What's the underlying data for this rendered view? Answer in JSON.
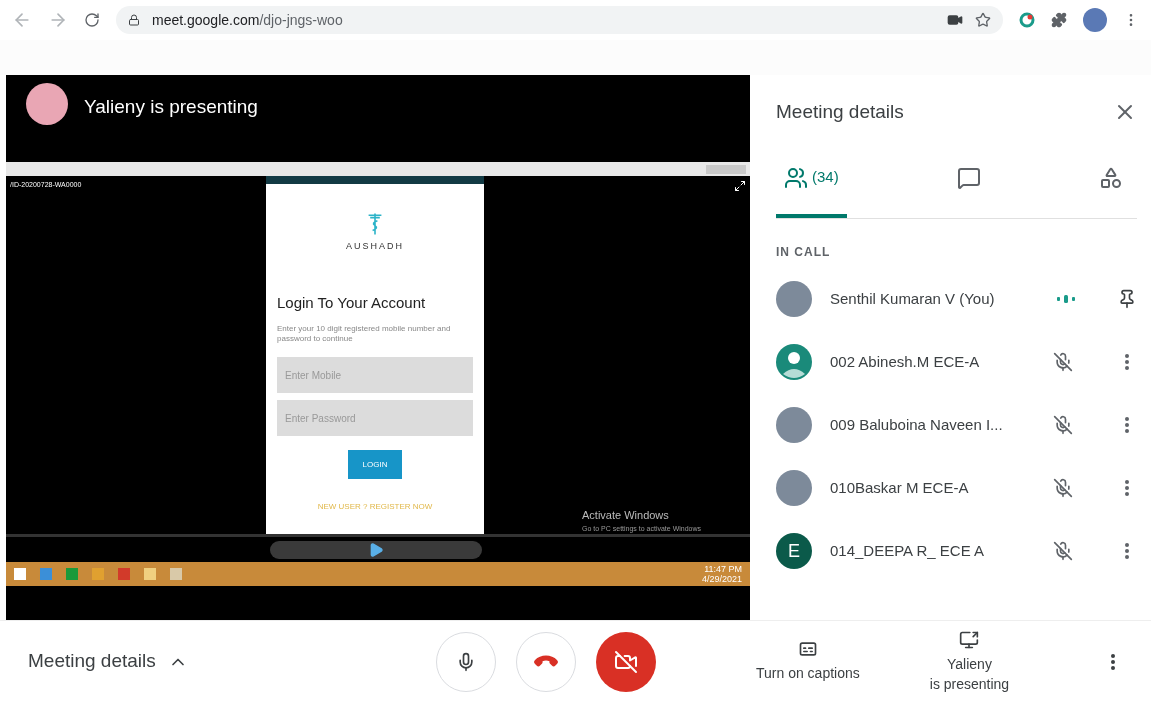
{
  "browser": {
    "url_host": "meet.google.com",
    "url_path": "/djo-jngs-woo"
  },
  "presenter": {
    "title": "Yalieny is presenting"
  },
  "shared_screen": {
    "file_name": "/ID-20200728-WA0000",
    "brand": "AUSHADH",
    "heading": "Login To Your Account",
    "description": "Enter your 10 digit registered mobile number and password to continue",
    "fields": [
      {
        "placeholder": "Enter Mobile"
      },
      {
        "placeholder": "Enter Password"
      }
    ],
    "button": "LOGIN",
    "register_link": "NEW USER ? REGISTER NOW",
    "activation_title": "Activate Windows",
    "activation_subtitle": "Go to PC settings to activate Windows",
    "clock_time": "11:47 PM",
    "clock_date": "4/29/2021"
  },
  "panel": {
    "title": "Meeting details",
    "tabs": [
      {
        "kind": "people",
        "label": "(34)",
        "selected": true
      },
      {
        "kind": "chat",
        "selected": false
      },
      {
        "kind": "activities",
        "selected": false
      }
    ],
    "section": "IN CALL",
    "participants": [
      {
        "name": "Senthil Kumaran V (You)",
        "avatar": {
          "kind": "photo"
        },
        "kind": "self"
      },
      {
        "name": "002 Abinesh.M ECE-A",
        "avatar": {
          "kind": "silhouette",
          "color": "#1a8a7a"
        },
        "kind": "muted"
      },
      {
        "name": "009 Baluboina Naveen I...",
        "avatar": {
          "kind": "photo"
        },
        "kind": "muted"
      },
      {
        "name": "010Baskar M ECE-A",
        "avatar": {
          "kind": "photo"
        },
        "kind": "muted"
      },
      {
        "name": "014_DEEPA R_ ECE A",
        "avatar": {
          "kind": "letter",
          "letter": "E",
          "color": "#0b5a4a"
        },
        "kind": "muted"
      }
    ]
  },
  "bottom_bar": {
    "details_label": "Meeting details",
    "controls": [
      {
        "kind": "mic",
        "on": true
      },
      {
        "kind": "hangup",
        "on": true
      },
      {
        "kind": "camera",
        "on": false
      }
    ],
    "captions_label": "Turn on captions",
    "presenting_lines": [
      "Yalieny",
      "is presenting"
    ]
  }
}
